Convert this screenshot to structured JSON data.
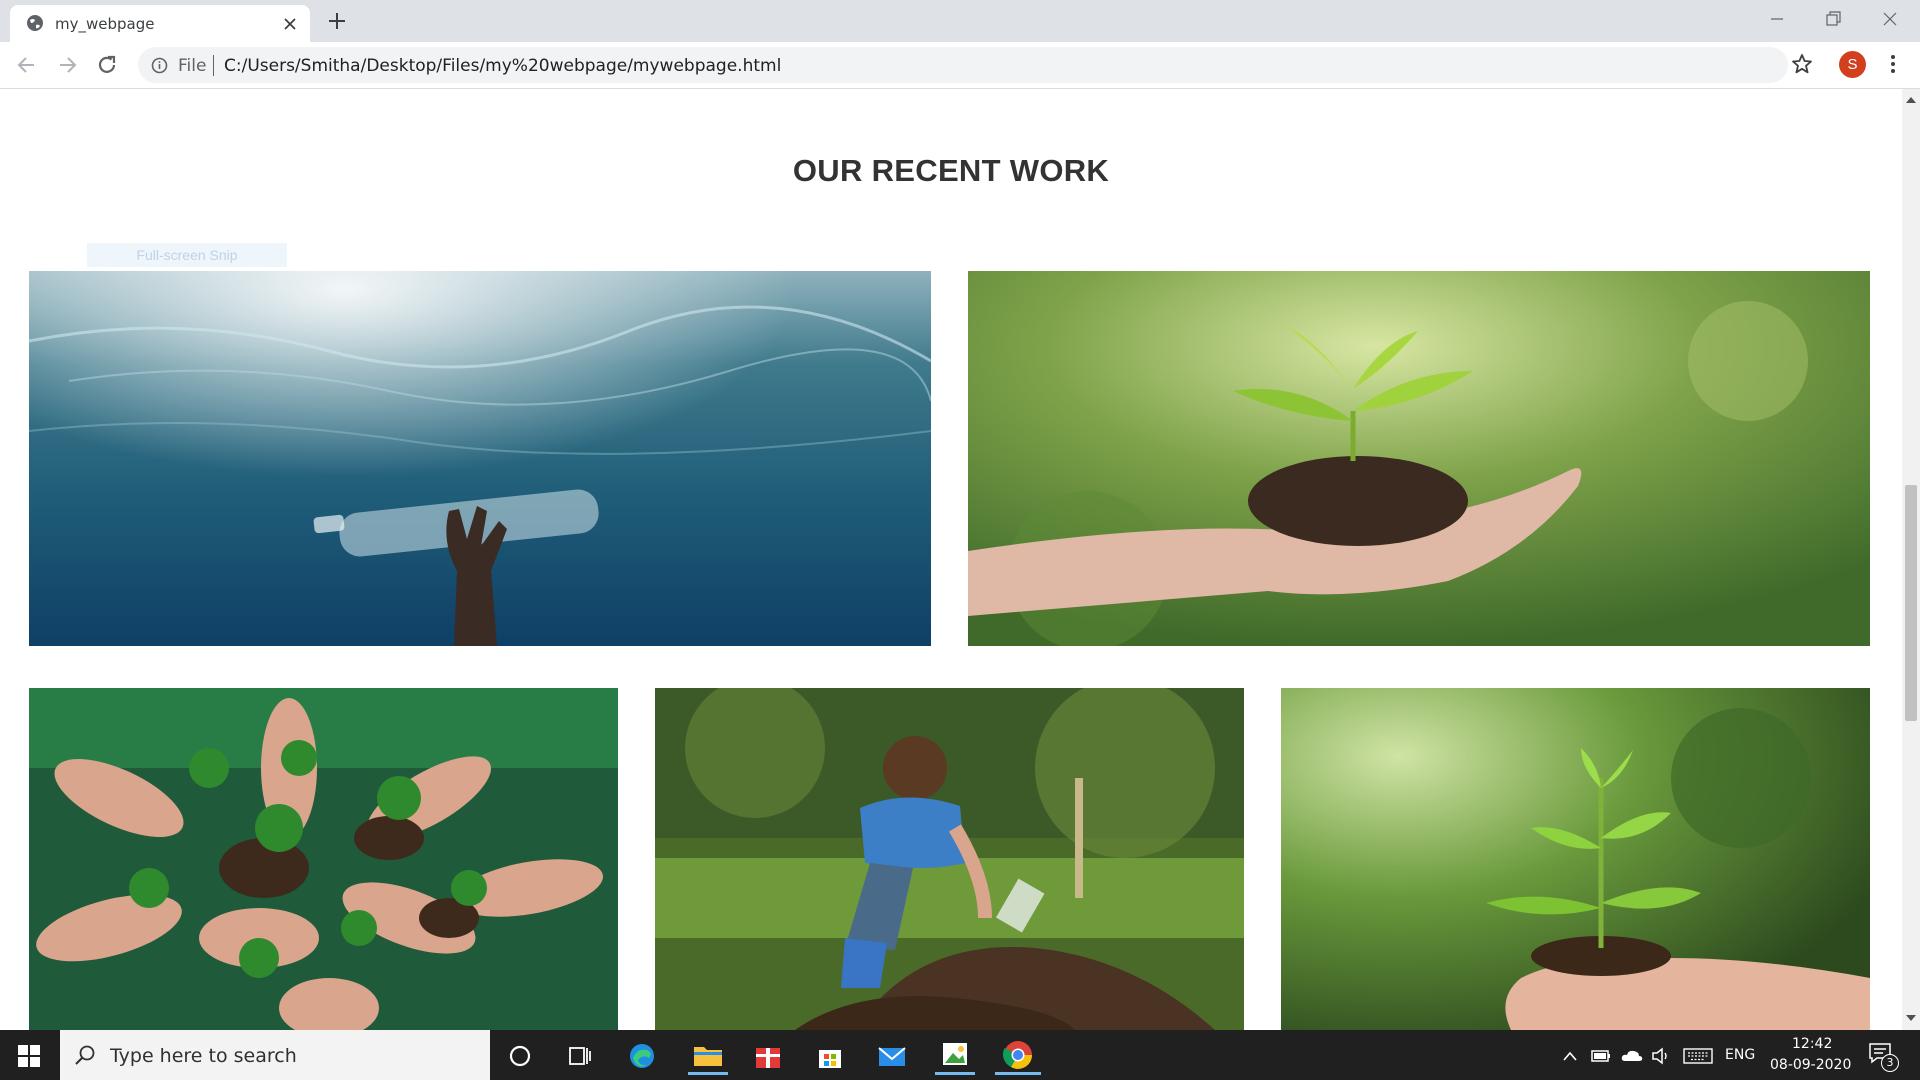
{
  "browser": {
    "tab_title": "my_webpage",
    "scheme_label": "File",
    "url": "C:/Users/Smitha/Desktop/Files/my%20webpage/mywebpage.html",
    "profile_initial": "S"
  },
  "page": {
    "section_title": "OUR RECENT WORK",
    "snip_label": "Full-screen Snip",
    "photos": [
      {
        "name": "bottle-underwater"
      },
      {
        "name": "seedling-in-hand"
      },
      {
        "name": "hands-with-plants"
      },
      {
        "name": "child-planting-tree"
      },
      {
        "name": "sapling-in-hands"
      }
    ]
  },
  "taskbar": {
    "search_placeholder": "Type here to search",
    "language": "ENG",
    "time": "12:42",
    "date": "08-09-2020",
    "notification_count": "3",
    "apps": [
      "cortana-icon",
      "task-view-icon",
      "edge-icon",
      "file-explorer-icon",
      "gift-app-icon",
      "store-icon",
      "mail-icon",
      "photo-app-icon",
      "chrome-icon"
    ]
  },
  "colors": {
    "tabstrip": "#dee1e6",
    "omnibox": "#f1f3f4",
    "avatar": "#d23f1e",
    "taskbar": "#202020",
    "title_text": "#333333"
  }
}
